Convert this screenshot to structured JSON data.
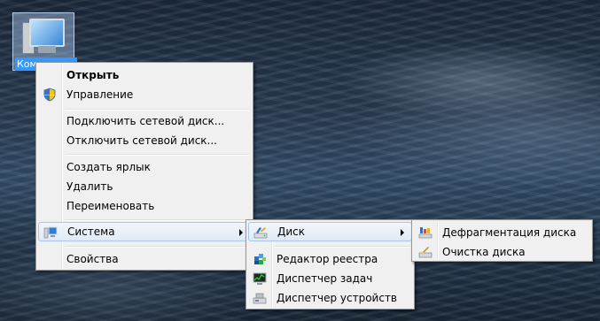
{
  "desktop": {
    "icon_label": "Компьютер"
  },
  "context_menu": {
    "open": "Открыть",
    "manage": "Управление",
    "map_drive": "Подключить сетевой диск...",
    "disconnect_drive": "Отключить сетевой диск...",
    "create_shortcut": "Создать ярлык",
    "delete": "Удалить",
    "rename": "Переименовать",
    "system": "Система",
    "properties": "Свойства"
  },
  "system_submenu": {
    "disk": "Диск",
    "registry_editor": "Редактор реестра",
    "task_manager": "Диспетчер задач",
    "device_manager": "Диспетчер устройств"
  },
  "disk_submenu": {
    "defrag": "Дефрагментация диска",
    "cleanup": "Очистка диска"
  }
}
